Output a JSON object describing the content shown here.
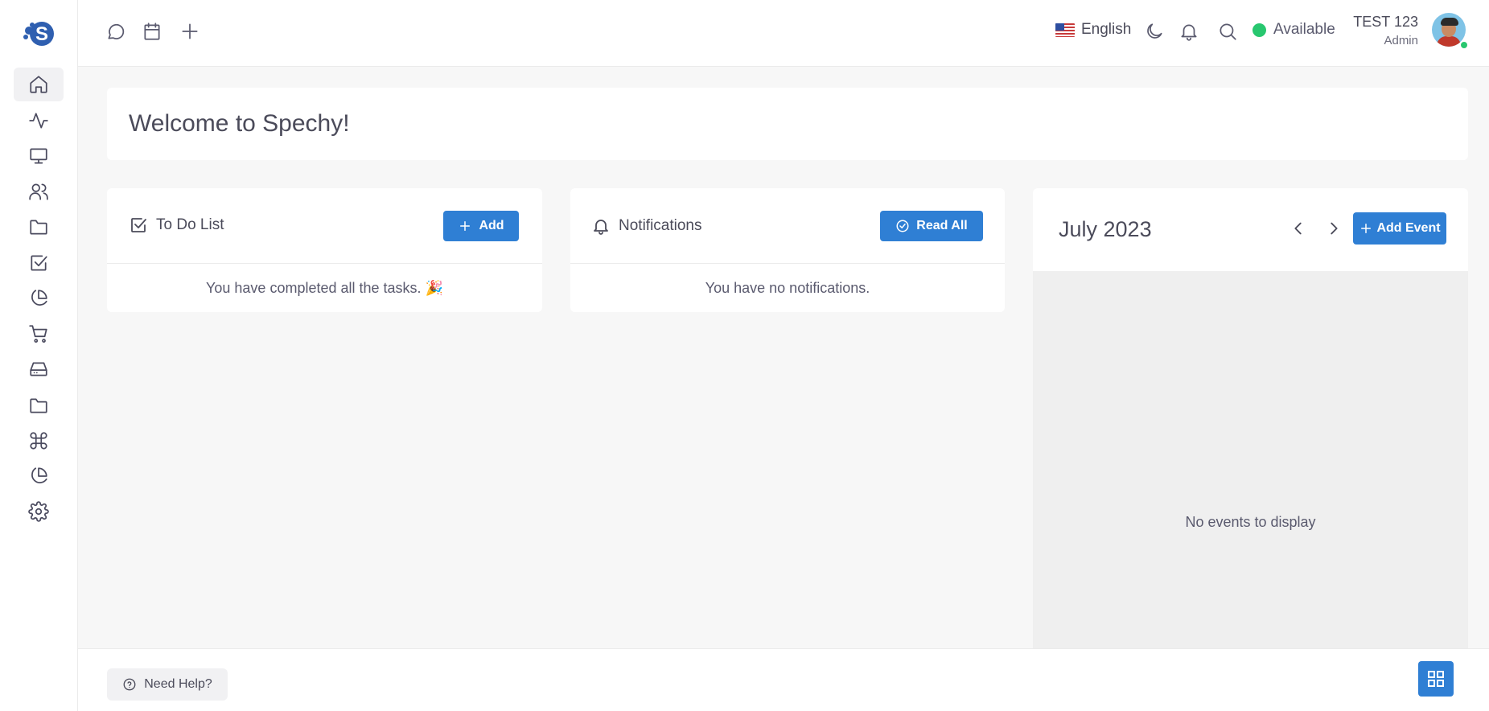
{
  "colors": {
    "primary": "#2f7fd4",
    "available": "#28c76f",
    "text": "#4b4b5a"
  },
  "sidebar": {
    "items": [
      {
        "name": "home-icon",
        "active": true
      },
      {
        "name": "activity-icon"
      },
      {
        "name": "monitor-icon"
      },
      {
        "name": "users-icon"
      },
      {
        "name": "folder-icon"
      },
      {
        "name": "checkbox-icon"
      },
      {
        "name": "pie-chart-icon"
      },
      {
        "name": "cart-icon"
      },
      {
        "name": "hard-drive-icon"
      },
      {
        "name": "folder-icon"
      },
      {
        "name": "command-icon"
      },
      {
        "name": "pie-chart-icon"
      },
      {
        "name": "settings-icon"
      }
    ]
  },
  "header": {
    "language": "English",
    "status": "Available",
    "user_name": "TEST 123",
    "user_role": "Admin"
  },
  "welcome": {
    "title": "Welcome to Spechy!"
  },
  "todo": {
    "title": "To Do List",
    "add_label": "Add",
    "empty": "You have completed all the tasks. 🎉"
  },
  "notifications": {
    "title": "Notifications",
    "read_all_label": "Read All",
    "empty": "You have no notifications."
  },
  "calendar": {
    "month": "July 2023",
    "add_event_label": "Add Event",
    "empty": "No events to display"
  },
  "footer": {
    "help_label": "Need Help?"
  }
}
